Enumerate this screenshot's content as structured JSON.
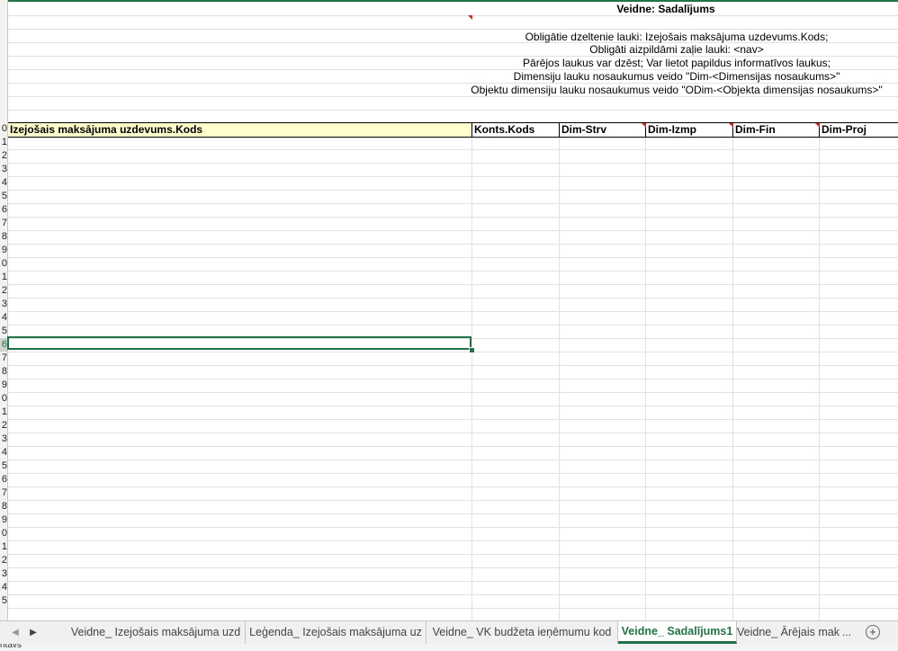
{
  "sheet": {
    "title": "Veidne: Sadalījums",
    "info_lines": [
      "Obligātie dzeltenie lauki: Izejošais maksājuma uzdevums.Kods;",
      "Obligāti aizpildāmi zaļie lauki: <nav>",
      "Pārējos laukus var dzēst; Var lietot papildus informatīvos laukus;",
      "Dimensiju lauku nosaukumus veido \"Dim-<Dimensijas nosaukums>\"",
      "Objektu dimensiju lauku nosaukumus veido \"ODim-<Objekta dimensijas nosaukums>\""
    ],
    "headers": [
      "Izejošais maksājuma uzdevums.Kods",
      "Konts.Kods",
      "Dim-Strv",
      "Dim-Izmp",
      "Dim-Fin",
      "Dim-Proj"
    ],
    "row_numbers": [
      "0",
      "1",
      "2",
      "3",
      "4",
      "5",
      "6",
      "7",
      "8",
      "9",
      "0",
      "1",
      "2",
      "3",
      "4",
      "5",
      "6",
      "7",
      "8",
      "9",
      "0",
      "1",
      "2",
      "3",
      "4",
      "5",
      "6",
      "7",
      "8",
      "9",
      "0",
      "1",
      "2",
      "3",
      "4",
      "5"
    ]
  },
  "tabs": {
    "items": [
      "Veidne_ Izejošais maksājuma uzd",
      "Leģenda_ Izejošais maksājuma uz",
      "Veidne_ VK budžeta ieņēmumu kod",
      "Veidne_ Sadalījums1",
      "Veidne_ Ārējais mak"
    ],
    "more": "...",
    "add": "+"
  },
  "status": {
    "text": "ntavs"
  },
  "colors": {
    "accent": "#217346",
    "header_yellow": "#ffffcc"
  }
}
